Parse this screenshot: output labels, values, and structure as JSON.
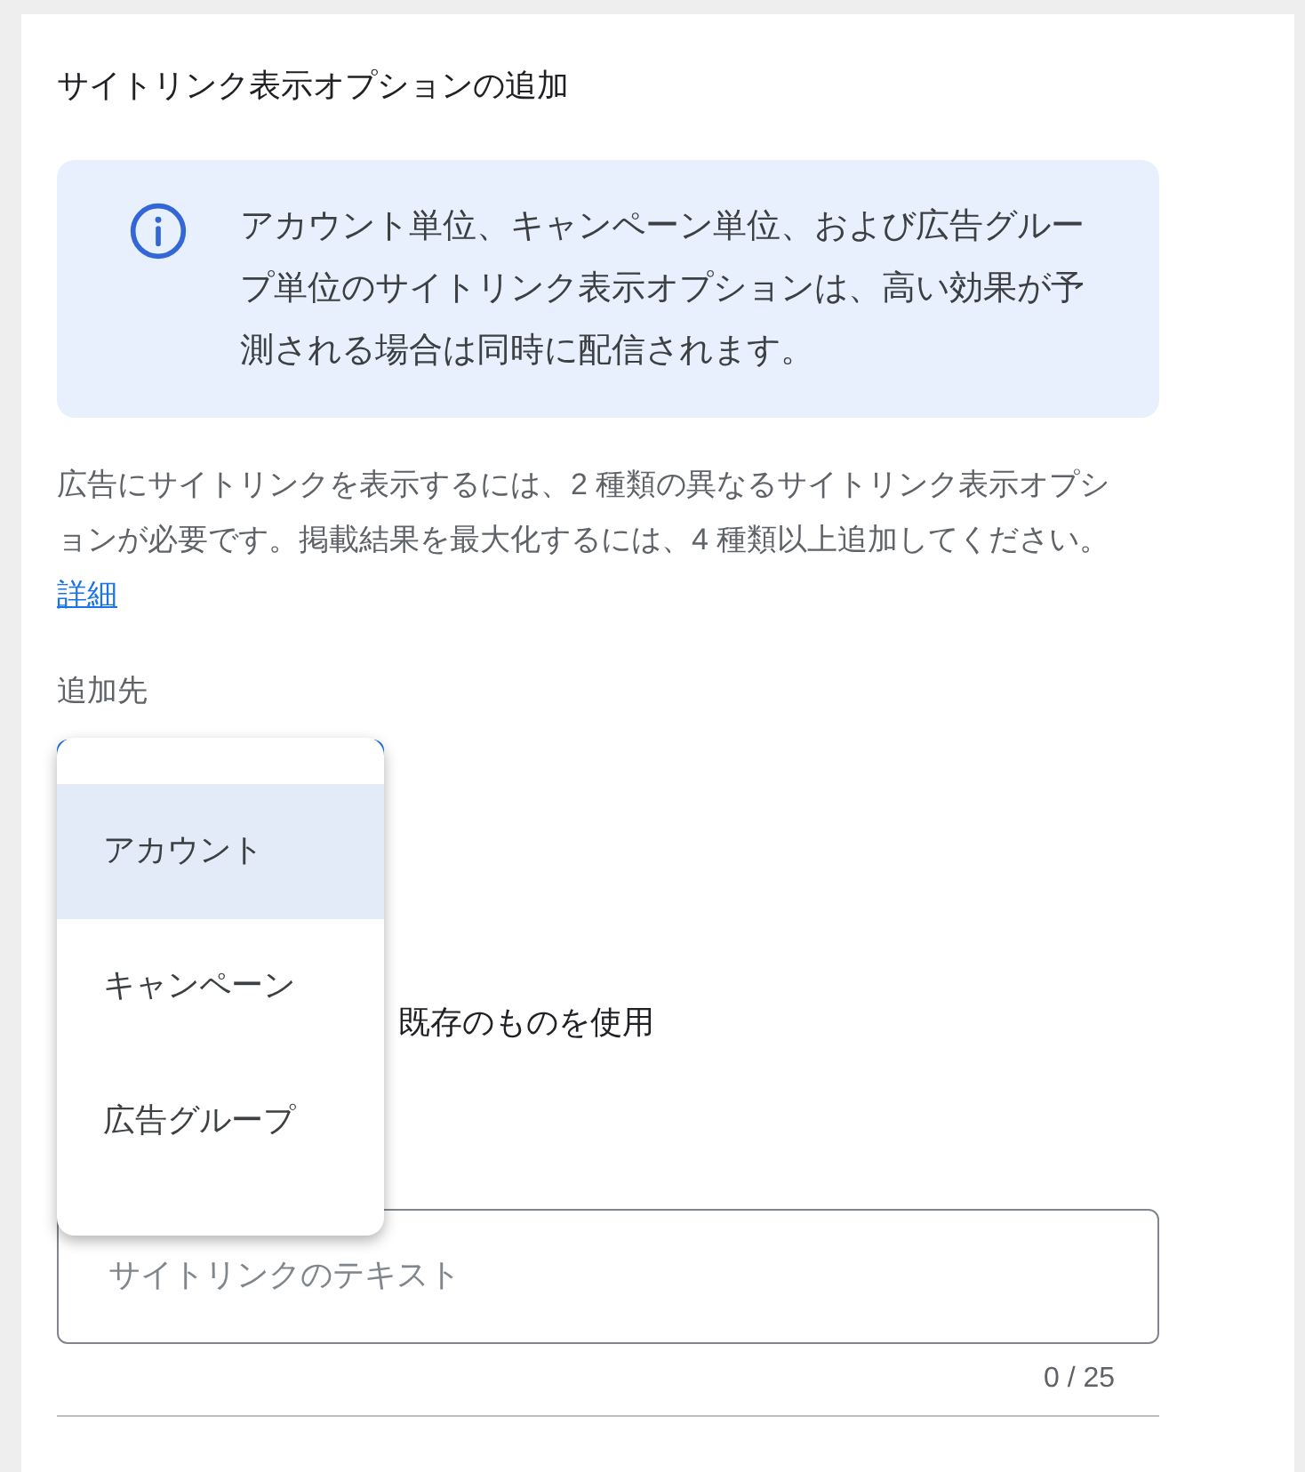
{
  "dialog": {
    "title": "サイトリンク表示オプションの追加"
  },
  "info": {
    "text": "アカウント単位、キャンペーン単位、および広告グループ単位のサイトリンク表示オプションは、高い効果が予測される場合は同時に配信されます。"
  },
  "description": {
    "text": "広告にサイトリンクを表示するには、2 種類の異なるサイトリンク表示オプションが必要です。掲載結果を最大化するには、4 種類以上追加してください。",
    "link": "詳細"
  },
  "add_to": {
    "label": "追加先",
    "menu": [
      {
        "label": "アカウント",
        "selected": true
      },
      {
        "label": "キャンペーン",
        "selected": false
      },
      {
        "label": "広告グループ",
        "selected": false
      }
    ]
  },
  "option": {
    "label": "既存のものを使用"
  },
  "sitelink_text": {
    "placeholder": "サイトリンクのテキスト",
    "counter": "0 / 25"
  }
}
